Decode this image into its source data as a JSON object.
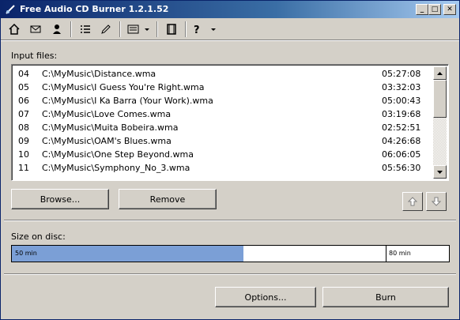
{
  "window": {
    "title": "Free Audio CD Burner 1.2.1.52"
  },
  "toolbar": {
    "icons": [
      "home-icon",
      "mail-icon",
      "user-icon",
      "list-icon",
      "edit-icon",
      "view-menu-icon",
      "film-icon",
      "help-icon"
    ]
  },
  "input_files": {
    "label": "Input files:",
    "rows": [
      {
        "num": "04",
        "path": "C:\\MyMusic\\Distance.wma",
        "duration": "05:27:08"
      },
      {
        "num": "05",
        "path": "C:\\MyMusic\\I Guess You're Right.wma",
        "duration": "03:32:03"
      },
      {
        "num": "06",
        "path": "C:\\MyMusic\\I Ka Barra (Your Work).wma",
        "duration": "05:00:43"
      },
      {
        "num": "07",
        "path": "C:\\MyMusic\\Love Comes.wma",
        "duration": "03:19:68"
      },
      {
        "num": "08",
        "path": "C:\\MyMusic\\Muita Bobeira.wma",
        "duration": "02:52:51"
      },
      {
        "num": "09",
        "path": "C:\\MyMusic\\OAM's Blues.wma",
        "duration": "04:26:68"
      },
      {
        "num": "10",
        "path": "C:\\MyMusic\\One Step Beyond.wma",
        "duration": "06:06:05"
      },
      {
        "num": "11",
        "path": "C:\\MyMusic\\Symphony_No_3.wma",
        "duration": "05:56:30"
      }
    ]
  },
  "buttons": {
    "browse": "Browse...",
    "remove": "Remove",
    "options": "Options...",
    "burn": "Burn"
  },
  "size_on_disc": {
    "label": "Size on disc:",
    "fill_label": "50 min",
    "limit_label": "80 min",
    "fill_fraction": 0.53,
    "marker_fraction": 0.855,
    "fill_color": "#7b9fd6"
  }
}
